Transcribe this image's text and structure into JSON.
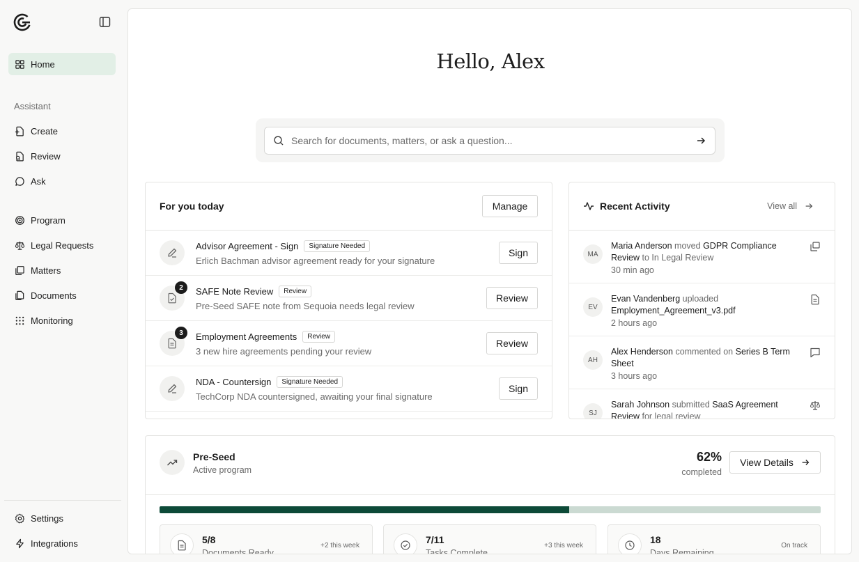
{
  "sidebar": {
    "home": "Home",
    "section_assistant": "Assistant",
    "create": "Create",
    "review": "Review",
    "ask": "Ask",
    "program": "Program",
    "legal_requests": "Legal Requests",
    "matters": "Matters",
    "documents": "Documents",
    "monitoring": "Monitoring",
    "settings": "Settings",
    "integrations": "Integrations"
  },
  "greeting": "Hello, Alex",
  "search": {
    "placeholder": "Search for documents, matters, or ask a question..."
  },
  "for_you": {
    "title": "For you today",
    "manage_label": "Manage",
    "items": [
      {
        "title": "Advisor Agreement - Sign",
        "tag": "Signature Needed",
        "desc": "Erlich Bachman advisor agreement ready for your signature",
        "action": "Sign",
        "icon": "pen-icon",
        "count": ""
      },
      {
        "title": "SAFE Note Review",
        "tag": "Review",
        "desc": "Pre-Seed SAFE note from Sequoia needs legal review",
        "action": "Review",
        "icon": "file-check-icon",
        "count": "2"
      },
      {
        "title": "Employment Agreements",
        "tag": "Review",
        "desc": "3 new hire agreements pending your review",
        "action": "Review",
        "icon": "document-icon",
        "count": "3"
      },
      {
        "title": "NDA - Countersign",
        "tag": "Signature Needed",
        "desc": "TechCorp NDA countersigned, awaiting your final signature",
        "action": "Sign",
        "icon": "pen-icon",
        "count": ""
      }
    ]
  },
  "recent": {
    "title": "Recent Activity",
    "view_all": "View all",
    "items": [
      {
        "initials": "MA",
        "name": "Maria Anderson",
        "verb": "moved",
        "object": "GDPR Compliance Review",
        "tail_muted": "to",
        "tail": "In Legal Review",
        "time": "30 min ago",
        "icon": "move-icon"
      },
      {
        "initials": "EV",
        "name": "Evan Vandenberg",
        "verb": "uploaded",
        "object": "Employment_Agreement_v3.pdf",
        "tail_muted": "",
        "tail": "",
        "time": "2 hours ago",
        "icon": "document-icon"
      },
      {
        "initials": "AH",
        "name": "Alex Henderson",
        "verb": "commented on",
        "object": "Series B Term Sheet",
        "tail_muted": "",
        "tail": "",
        "time": "3 hours ago",
        "icon": "comment-icon"
      },
      {
        "initials": "SJ",
        "name": "Sarah Johnson",
        "verb": "submitted",
        "object": "SaaS Agreement Review",
        "tail_muted": "for legal review",
        "tail": "",
        "time": "",
        "icon": "scale-icon"
      }
    ]
  },
  "program": {
    "name": "Pre-Seed",
    "status": "Active program",
    "percent_label": "62%",
    "completed_label": "completed",
    "progress_fraction": 0.62,
    "view_details": "View Details",
    "stats": [
      {
        "value": "5/8",
        "label": "Documents Ready",
        "pill": "+2 this week",
        "icon": "document-icon"
      },
      {
        "value": "7/11",
        "label": "Tasks Complete",
        "pill": "+3 this week",
        "icon": "check-circle-icon"
      },
      {
        "value": "18",
        "label": "Days Remaining",
        "pill": "On track",
        "icon": "clock-icon"
      }
    ]
  },
  "colors": {
    "accent": "#0d4a38",
    "accent_light": "#cbdad2",
    "nav_active": "#e2efe6"
  }
}
